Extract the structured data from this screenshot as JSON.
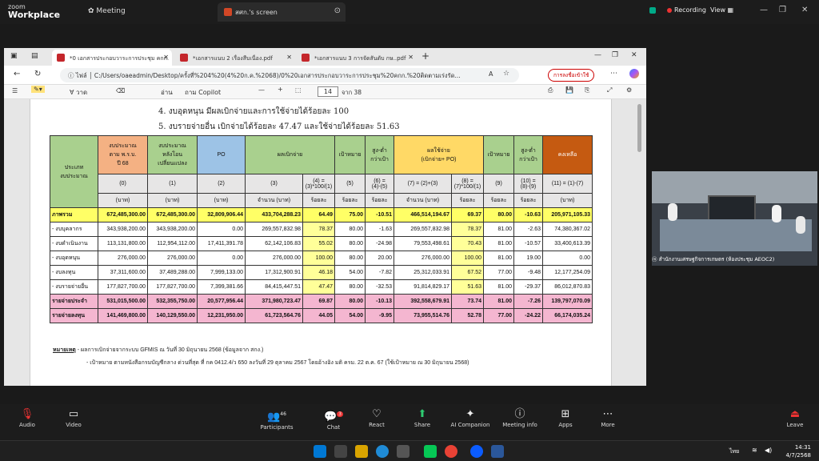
{
  "zoom": {
    "brand_top": "zoom",
    "brand_bottom": "Workplace",
    "meeting_label": "Meeting",
    "share_tab": "สศก.'s screen",
    "recording": "Recording",
    "view": "View"
  },
  "edge": {
    "tabs": [
      {
        "label": "*0 เอกสารประกอบวาระการประชุม คกก."
      },
      {
        "label": "*เอกสารแนบ 2 เรื่องสืบเนื่อง.pdf"
      },
      {
        "label": "*เอกสารแนบ 3 การจัดสันดับ กษ..pdf"
      }
    ],
    "file_label": "ไฟล์",
    "url": "C:/Users/oaeadmin/Desktop/ครั้งที่%204%20(4%20ก.ค.%2068)/0%20เอกสารประกอบวาระการประชุม%20คกก.%20ติดตามเร่งรัด...",
    "signin": "การลงชื่อเข้าใช้",
    "toolbar": {
      "draw": "วาด",
      "read_aloud": "อ่าน",
      "ask_copilot": "ถาม Copilot",
      "page": "14",
      "of": "จาก 38"
    }
  },
  "doc": {
    "line4": "4. งบอุดหนุน มีผลเบิกจ่ายและการใช้จ่ายได้ร้อยละ 100",
    "line5": "5. งบรายจ่ายอื่น เบิกจ่ายได้ร้อยละ 47.47 และใช้จ่ายได้ร้อยละ 51.63",
    "header": {
      "type": "ประเภท\nงบประมาณ",
      "budget": "งบประมาณ\nตาม พ.ร.บ.\nปี 68",
      "after": "งบประมาณ\nหลังโอน\nเปลี่ยนแปลง",
      "po": "PO",
      "disb": "ผลเบิกจ่าย",
      "target1": "เป้าหมาย",
      "diff1": "สูง-ต่ำ\nกว่าเป้า",
      "use": "ผลใช้จ่าย\n(เบิกจ่าย+ PO)",
      "target2": "เป้าหมาย",
      "diff2": "สูง-ต่ำ\nกว่าเป้า",
      "remain": "คงเหลือ",
      "c0": "(0)",
      "c1": "(1)",
      "c2": "(2)",
      "c3": "(3)",
      "c4": "(4) =\n(3)*100/(1)",
      "c5": "(5)",
      "c6": "(6) =\n(4)-(5)",
      "c7": "(7) = (2)+(3)",
      "c8": "(8) =\n(7)*100/(1)",
      "c9": "(9)",
      "c10": "(10) =\n(8)-(9)",
      "c11": "(11) = (1)-(7)",
      "baht": "(บาท)",
      "amount": "จำนวน (บาท)",
      "percent": "ร้อยละ"
    },
    "rows": [
      {
        "name": "ภาพรวม",
        "v": [
          "672,485,300.00",
          "672,485,300.00",
          "32,809,906.44",
          "433,704,288.23",
          "64.49",
          "75.00",
          "-10.51",
          "466,514,194.67",
          "69.37",
          "80.00",
          "-10.63",
          "205,971,105.33"
        ]
      },
      {
        "name": "- งบบุคลากร",
        "v": [
          "343,938,200.00",
          "343,938,200.00",
          "0.00",
          "269,557,832.98",
          "78.37",
          "80.00",
          "-1.63",
          "269,557,832.98",
          "78.37",
          "81.00",
          "-2.63",
          "74,380,367.02"
        ]
      },
      {
        "name": "- งบดำเนินงาน",
        "v": [
          "113,131,800.00",
          "112,954,112.00",
          "17,411,391.78",
          "62,142,106.83",
          "55.02",
          "80.00",
          "-24.98",
          "79,553,498.61",
          "70.43",
          "81.00",
          "-10.57",
          "33,400,613.39"
        ]
      },
      {
        "name": "- งบอุดหนุน",
        "v": [
          "276,000.00",
          "276,000.00",
          "0.00",
          "276,000.00",
          "100.00",
          "80.00",
          "20.00",
          "276,000.00",
          "100.00",
          "81.00",
          "19.00",
          "0.00"
        ]
      },
      {
        "name": "- งบลงทุน",
        "v": [
          "37,311,600.00",
          "37,489,288.00",
          "7,999,133.00",
          "17,312,900.91",
          "46.18",
          "54.00",
          "-7.82",
          "25,312,033.91",
          "67.52",
          "77.00",
          "-9.48",
          "12,177,254.09"
        ]
      },
      {
        "name": "- งบรายจ่ายอื่น",
        "v": [
          "177,827,700.00",
          "177,827,700.00",
          "7,399,381.66",
          "84,415,447.51",
          "47.47",
          "80.00",
          "-32.53",
          "91,814,829.17",
          "51.63",
          "81.00",
          "-29.37",
          "86,012,870.83"
        ]
      },
      {
        "name": "รายจ่ายประจำ",
        "v": [
          "531,015,500.00",
          "532,355,750.00",
          "20,577,956.44",
          "371,980,723.47",
          "69.87",
          "80.00",
          "-10.13",
          "392,558,679.91",
          "73.74",
          "81.00",
          "-7.26",
          "139,797,070.09"
        ]
      },
      {
        "name": "รายจ่ายลงทุน",
        "v": [
          "141,469,800.00",
          "140,129,550.00",
          "12,231,950.00",
          "61,723,564.76",
          "44.05",
          "54.00",
          "-9.95",
          "73,955,514.76",
          "52.78",
          "77.00",
          "-24.22",
          "66,174,035.24"
        ]
      }
    ],
    "note_label": "หมายเหตุ",
    "note1": "- ผลการเบิกจ่ายจากระบบ GFMIS ณ วันที่ 30 มิถุนายน 2568 (ข้อมูลจาก สกง.)",
    "note2": "- เป้าหมาย ตามหนังสือกรมบัญชีกลาง ด่วนที่สุด ที่ กค 0412.4/ว 650 ลงวันที่ 29 ตุลาคม 2567 โดยอ้างอิง มติ ครม. 22 ต.ค. 67 (ใช้เป้าหมาย ณ 30 มิถุนายน 2568)"
  },
  "video": {
    "name": "สำนักงานเศรษฐกิจการเกษตร (ห้องประชุม AEOC2)"
  },
  "controls": {
    "audio": "Audio",
    "video": "Video",
    "participants": "Participants",
    "participants_count": "46",
    "chat": "Chat",
    "chat_badge": "3",
    "react": "React",
    "share": "Share",
    "companion": "AI Companion",
    "info": "Meeting info",
    "apps": "Apps",
    "more": "More",
    "leave": "Leave"
  },
  "taskbar": {
    "lang": "ไทย",
    "time": "14:31",
    "date": "4/7/2568"
  }
}
